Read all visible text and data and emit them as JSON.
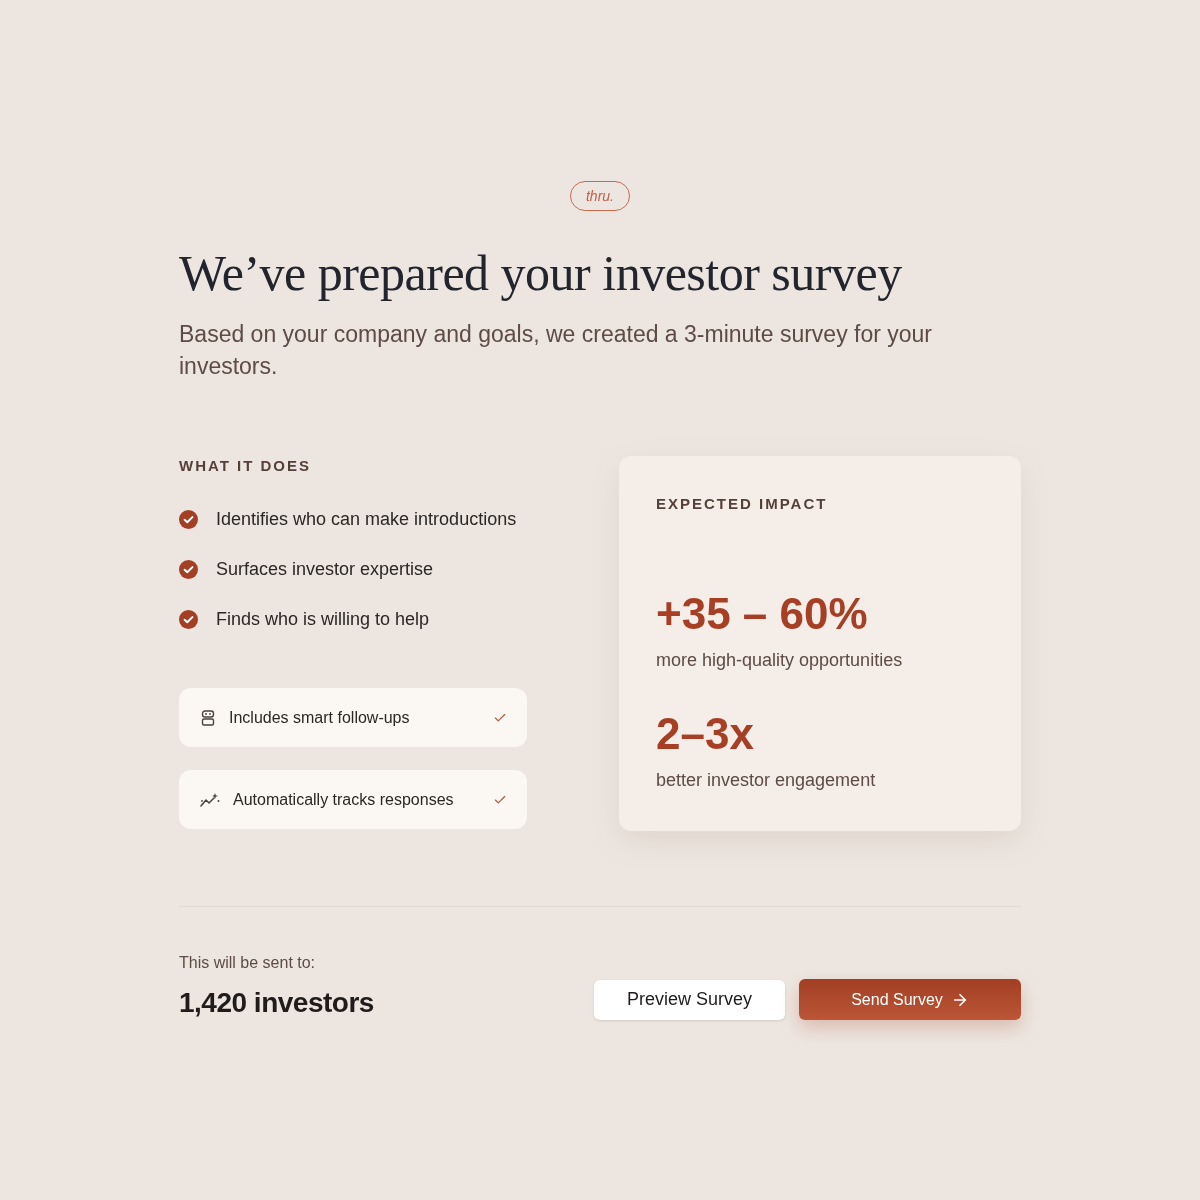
{
  "logo": {
    "text": "thru."
  },
  "header": {
    "title": "We’ve prepared your investor survey",
    "subtitle": "Based on your company and goals, we created a 3-minute survey for your investors."
  },
  "what_it_does": {
    "heading": "WHAT IT DOES",
    "items": [
      "Identifies who can make introductions",
      "Surfaces investor expertise",
      "Finds who is willing to help"
    ],
    "features": [
      {
        "label": "Includes smart follow-ups"
      },
      {
        "label": "Automatically tracks responses"
      }
    ]
  },
  "expected_impact": {
    "heading": "EXPECTED IMPACT",
    "stats": [
      {
        "value": "+35 – 60%",
        "caption": "more high-quality opportunities"
      },
      {
        "value": "2–3x",
        "caption": "better investor engagement"
      }
    ]
  },
  "footer": {
    "recipients_label": "This will be sent to:",
    "recipients_count": "1,420 investors",
    "buttons": [
      {
        "label": "Preview Survey",
        "kind": "secondary"
      },
      {
        "label": "Send Survey",
        "kind": "primary"
      }
    ]
  }
}
